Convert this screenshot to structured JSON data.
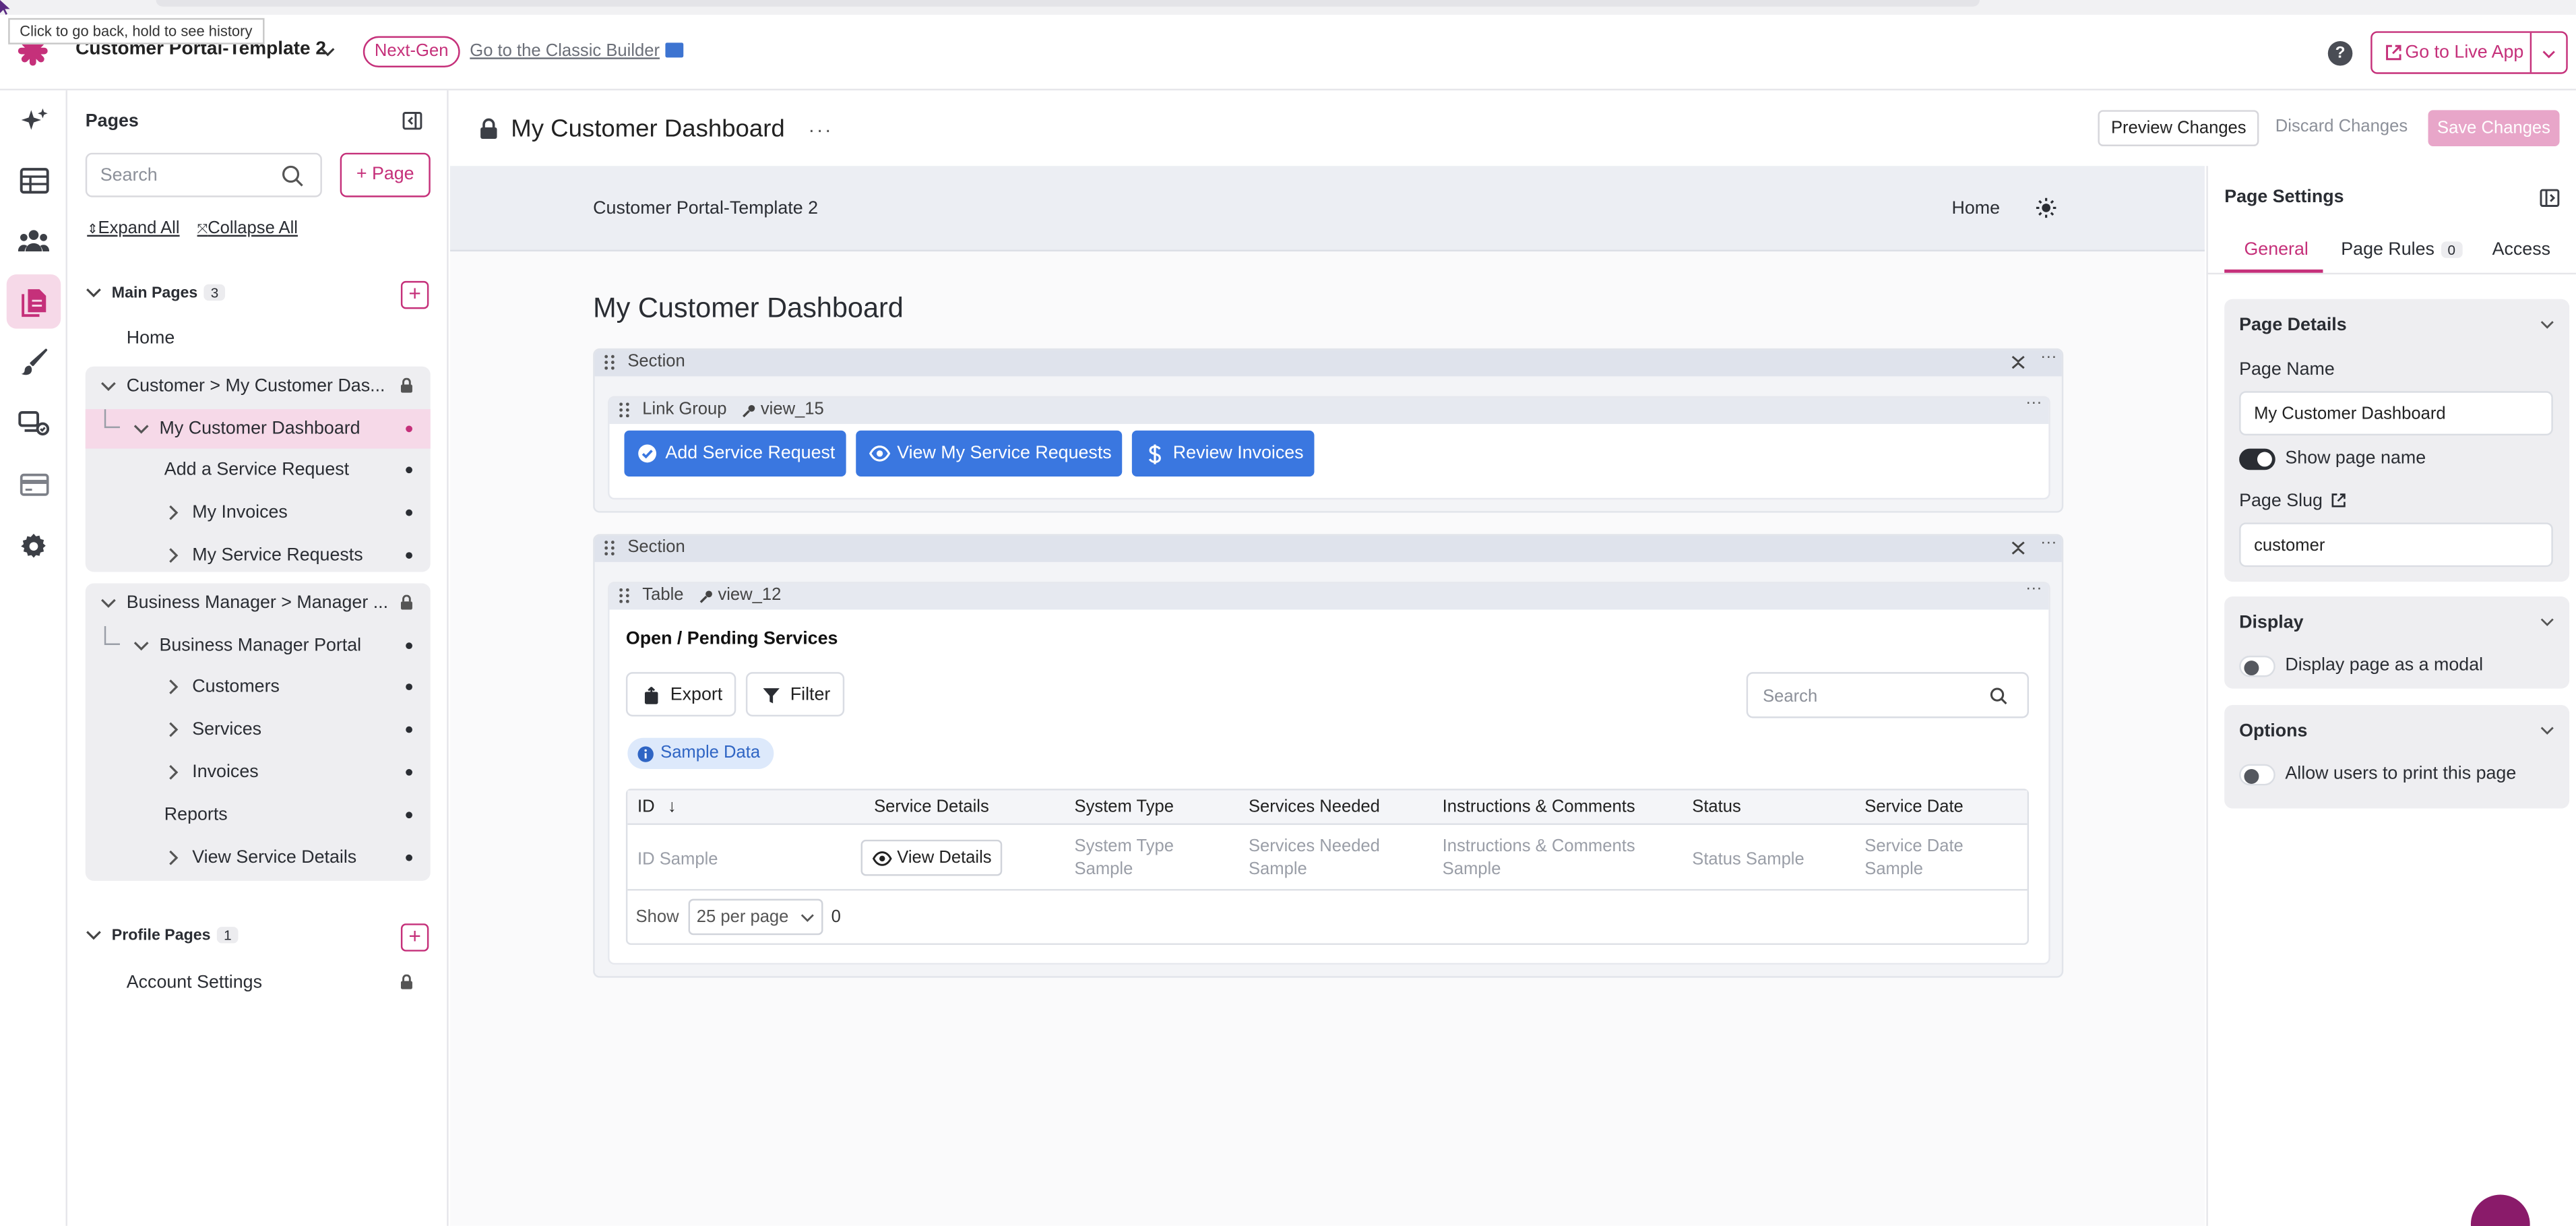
{
  "browser": {
    "tooltip": "Click to go back, hold to see history"
  },
  "topbar": {
    "app_name": "Customer Portal-Template 2",
    "badge": "Next-Gen",
    "classic_link": "Go to the Classic Builder",
    "help": "?",
    "live_app": "Go to Live App",
    "brand_color": "#c5307a"
  },
  "rail": {
    "items": [
      "sparkle-icon",
      "table-icon",
      "users-icon",
      "pages-icon",
      "brush-icon",
      "flows-icon",
      "payments-icon",
      "gear-icon"
    ],
    "active": "pages-icon"
  },
  "pages": {
    "title": "Pages",
    "search_placeholder": "Search",
    "add_label": "+ Page",
    "expand_all": "Expand All",
    "collapse_all": "Collapse All",
    "main_pages": {
      "label": "Main Pages",
      "count": "3"
    },
    "home": "Home",
    "customer_group": {
      "label": "Customer > My Customer Das...",
      "items": [
        "My Customer Dashboard",
        "Add a Service Request",
        "My Invoices",
        "My Service Requests"
      ]
    },
    "manager_group": {
      "label": "Business Manager > Manager ...",
      "items": [
        "Business Manager Portal",
        "Customers",
        "Services",
        "Invoices",
        "Reports",
        "View Service Details"
      ]
    },
    "profile_pages": {
      "label": "Profile Pages",
      "count": "1"
    },
    "account_settings": "Account Settings"
  },
  "main": {
    "page_title": "My Customer Dashboard",
    "more": "···",
    "preview": "Preview Changes",
    "discard": "Discard Changes",
    "save": "Save Changes",
    "site_name": "Customer Portal-Template 2",
    "site_home": "Home",
    "heading": "My Customer Dashboard",
    "section_label": "Section",
    "link_group": {
      "label": "Link Group",
      "key": "view_15",
      "buttons": [
        "Add Service Request",
        "View My Service Requests",
        "Review Invoices"
      ]
    },
    "table_view": {
      "label": "Table",
      "key": "view_12",
      "title": "Open / Pending Services",
      "export": "Export",
      "filter": "Filter",
      "search_placeholder": "Search",
      "sample_badge": "Sample Data",
      "columns": [
        "ID",
        "Service Details",
        "System Type",
        "Services Needed",
        "Instructions & Comments",
        "Status",
        "Service Date"
      ],
      "row": {
        "id": "ID Sample",
        "details_button": "View Details",
        "system_type": [
          "System Type",
          "Sample"
        ],
        "services_needed": [
          "Services Needed",
          "Sample"
        ],
        "instructions": [
          "Instructions & Comments",
          "Sample"
        ],
        "status": "Status Sample",
        "service_date": [
          "Service Date",
          "Sample"
        ]
      },
      "pager": {
        "show": "Show",
        "per_page": "25 per page",
        "count": "0"
      }
    }
  },
  "settings": {
    "title": "Page Settings",
    "tabs": {
      "general": "General",
      "rules": "Page Rules",
      "rules_count": "0",
      "access": "Access"
    },
    "details": {
      "header": "Page Details",
      "name_label": "Page Name",
      "name_value": "My Customer Dashboard",
      "show_name": "Show page name",
      "show_name_on": true,
      "slug_label": "Page Slug",
      "slug_value": "customer"
    },
    "display": {
      "header": "Display",
      "modal": "Display page as a modal",
      "modal_on": false
    },
    "options": {
      "header": "Options",
      "print": "Allow users to print this page",
      "print_on": false
    }
  }
}
